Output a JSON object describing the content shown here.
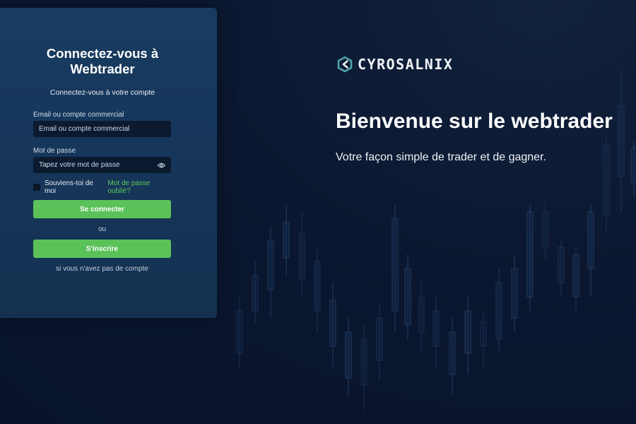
{
  "login": {
    "title": "Connectez-vous à Webtrader",
    "subtitle": "Connectez-vous à votre compte",
    "email_label": "Email ou compte commercial",
    "email_placeholder": "Email ou compte commercial",
    "email_value": "",
    "password_label": "Mot de passe",
    "password_placeholder": "Tapez votre mot de passe",
    "password_value": "",
    "remember_label": "Souviens-toi de moi",
    "remember_checked": false,
    "forgot_link": "Mot de passe oublié?",
    "login_button": "Se connecter",
    "or_text": "ou",
    "signup_button": "S'inscrire",
    "no_account_text": "si vous n'avez pas de compte"
  },
  "brand": {
    "name": "CYROSALNIX",
    "logo_icon": "hexagon-chevron-logo-icon"
  },
  "hero": {
    "title": "Bienvenue sur le webtrader",
    "subtitle": "Votre façon simple de trader et de gagner."
  },
  "colors": {
    "background": "#0b1730",
    "panel": "#163659",
    "input": "#0c1a30",
    "accent_green": "#5bc25a",
    "logo_teal": "#4fa5a8"
  }
}
